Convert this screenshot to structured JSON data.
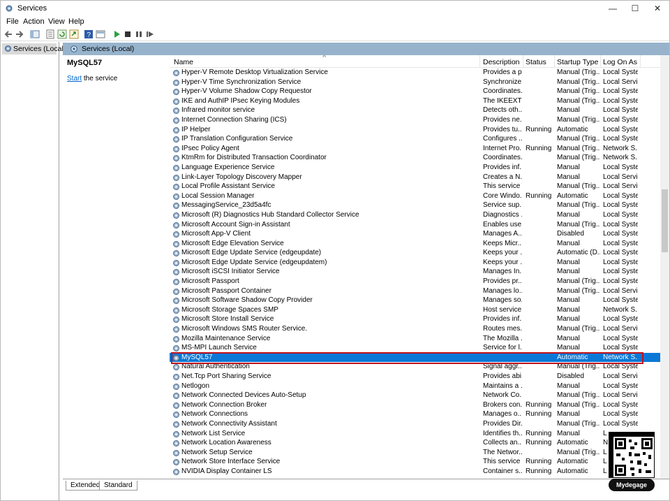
{
  "window": {
    "title": "Services"
  },
  "menu": [
    "File",
    "Action",
    "View",
    "Help"
  ],
  "tree": {
    "item": "Services (Local)"
  },
  "right_header": "Services (Local)",
  "desc_pane": {
    "title": "MySQL57",
    "link": "Start",
    "link_suffix": " the service"
  },
  "columns": [
    "Name",
    "Description",
    "Status",
    "Startup Type",
    "Log On As"
  ],
  "rows": [
    {
      "name": "Hyper-V Remote Desktop Virtualization Service",
      "desc": "Provides a p...",
      "status": "",
      "startup": "Manual (Trig...",
      "logon": "Local Syste..."
    },
    {
      "name": "Hyper-V Time Synchronization Service",
      "desc": "Synchronize...",
      "status": "",
      "startup": "Manual (Trig...",
      "logon": "Local Service"
    },
    {
      "name": "Hyper-V Volume Shadow Copy Requestor",
      "desc": "Coordinates...",
      "status": "",
      "startup": "Manual (Trig...",
      "logon": "Local Syste..."
    },
    {
      "name": "IKE and AuthIP IPsec Keying Modules",
      "desc": "The IKEEXT ...",
      "status": "",
      "startup": "Manual (Trig...",
      "logon": "Local Syste..."
    },
    {
      "name": "Infrared monitor service",
      "desc": "Detects oth...",
      "status": "",
      "startup": "Manual",
      "logon": "Local Syste..."
    },
    {
      "name": "Internet Connection Sharing (ICS)",
      "desc": "Provides ne...",
      "status": "",
      "startup": "Manual (Trig...",
      "logon": "Local Syste..."
    },
    {
      "name": "IP Helper",
      "desc": "Provides tu...",
      "status": "Running",
      "startup": "Automatic",
      "logon": "Local Syste..."
    },
    {
      "name": "IP Translation Configuration Service",
      "desc": "Configures ...",
      "status": "",
      "startup": "Manual (Trig...",
      "logon": "Local Syste..."
    },
    {
      "name": "IPsec Policy Agent",
      "desc": "Internet Pro...",
      "status": "Running",
      "startup": "Manual (Trig...",
      "logon": "Network S..."
    },
    {
      "name": "KtmRm for Distributed Transaction Coordinator",
      "desc": "Coordinates...",
      "status": "",
      "startup": "Manual (Trig...",
      "logon": "Network S..."
    },
    {
      "name": "Language Experience Service",
      "desc": "Provides inf...",
      "status": "",
      "startup": "Manual",
      "logon": "Local Syste..."
    },
    {
      "name": "Link-Layer Topology Discovery Mapper",
      "desc": "Creates a N...",
      "status": "",
      "startup": "Manual",
      "logon": "Local Service"
    },
    {
      "name": "Local Profile Assistant Service",
      "desc": "This service ...",
      "status": "",
      "startup": "Manual (Trig...",
      "logon": "Local Service"
    },
    {
      "name": "Local Session Manager",
      "desc": "Core Windo...",
      "status": "Running",
      "startup": "Automatic",
      "logon": "Local Syste..."
    },
    {
      "name": "MessagingService_23d5a4fc",
      "desc": "Service sup...",
      "status": "",
      "startup": "Manual (Trig...",
      "logon": "Local Syste..."
    },
    {
      "name": "Microsoft (R) Diagnostics Hub Standard Collector Service",
      "desc": "Diagnostics ...",
      "status": "",
      "startup": "Manual",
      "logon": "Local Syste..."
    },
    {
      "name": "Microsoft Account Sign-in Assistant",
      "desc": "Enables use...",
      "status": "",
      "startup": "Manual (Trig...",
      "logon": "Local Syste..."
    },
    {
      "name": "Microsoft App-V Client",
      "desc": "Manages A...",
      "status": "",
      "startup": "Disabled",
      "logon": "Local Syste..."
    },
    {
      "name": "Microsoft Edge Elevation Service",
      "desc": "Keeps Micr...",
      "status": "",
      "startup": "Manual",
      "logon": "Local Syste..."
    },
    {
      "name": "Microsoft Edge Update Service (edgeupdate)",
      "desc": "Keeps your ...",
      "status": "",
      "startup": "Automatic (D...",
      "logon": "Local Syste..."
    },
    {
      "name": "Microsoft Edge Update Service (edgeupdatem)",
      "desc": "Keeps your ...",
      "status": "",
      "startup": "Manual",
      "logon": "Local Syste..."
    },
    {
      "name": "Microsoft iSCSI Initiator Service",
      "desc": "Manages In...",
      "status": "",
      "startup": "Manual",
      "logon": "Local Syste..."
    },
    {
      "name": "Microsoft Passport",
      "desc": "Provides pr...",
      "status": "",
      "startup": "Manual (Trig...",
      "logon": "Local Syste..."
    },
    {
      "name": "Microsoft Passport Container",
      "desc": "Manages lo...",
      "status": "",
      "startup": "Manual (Trig...",
      "logon": "Local Service"
    },
    {
      "name": "Microsoft Software Shadow Copy Provider",
      "desc": "Manages so...",
      "status": "",
      "startup": "Manual",
      "logon": "Local Syste..."
    },
    {
      "name": "Microsoft Storage Spaces SMP",
      "desc": "Host service...",
      "status": "",
      "startup": "Manual",
      "logon": "Network S..."
    },
    {
      "name": "Microsoft Store Install Service",
      "desc": "Provides inf...",
      "status": "",
      "startup": "Manual",
      "logon": "Local Syste..."
    },
    {
      "name": "Microsoft Windows SMS Router Service.",
      "desc": "Routes mes...",
      "status": "",
      "startup": "Manual (Trig...",
      "logon": "Local Service"
    },
    {
      "name": "Mozilla Maintenance Service",
      "desc": "The Mozilla ...",
      "status": "",
      "startup": "Manual",
      "logon": "Local Syste..."
    },
    {
      "name": "MS-MPI Launch Service",
      "desc": "Service for l...",
      "status": "",
      "startup": "Manual",
      "logon": "Local Syste..."
    },
    {
      "name": "MySQL57",
      "desc": "",
      "status": "",
      "startup": "Automatic",
      "logon": "Network S...",
      "selected": true
    },
    {
      "name": "Natural Authentication",
      "desc": "Signal aggr...",
      "status": "",
      "startup": "Manual (Trig...",
      "logon": "Local Syste..."
    },
    {
      "name": "Net.Tcp Port Sharing Service",
      "desc": "Provides abi...",
      "status": "",
      "startup": "Disabled",
      "logon": "Local Service"
    },
    {
      "name": "Netlogon",
      "desc": "Maintains a ...",
      "status": "",
      "startup": "Manual",
      "logon": "Local Syste..."
    },
    {
      "name": "Network Connected Devices Auto-Setup",
      "desc": "Network Co...",
      "status": "",
      "startup": "Manual (Trig...",
      "logon": "Local Service"
    },
    {
      "name": "Network Connection Broker",
      "desc": "Brokers con...",
      "status": "Running",
      "startup": "Manual (Trig...",
      "logon": "Local Syste..."
    },
    {
      "name": "Network Connections",
      "desc": "Manages o...",
      "status": "Running",
      "startup": "Manual",
      "logon": "Local Syste..."
    },
    {
      "name": "Network Connectivity Assistant",
      "desc": "Provides Dir...",
      "status": "",
      "startup": "Manual (Trig...",
      "logon": "Local Syste..."
    },
    {
      "name": "Network List Service",
      "desc": "Identifies th...",
      "status": "Running",
      "startup": "Manual",
      "logon": "L"
    },
    {
      "name": "Network Location Awareness",
      "desc": "Collects an...",
      "status": "Running",
      "startup": "Automatic",
      "logon": "N"
    },
    {
      "name": "Network Setup Service",
      "desc": "The Networ...",
      "status": "",
      "startup": "Manual (Trig...",
      "logon": "L"
    },
    {
      "name": "Network Store Interface Service",
      "desc": "This service ...",
      "status": "Running",
      "startup": "Automatic",
      "logon": "L"
    },
    {
      "name": "NVIDIA Display Container LS",
      "desc": "Container s...",
      "status": "Running",
      "startup": "Automatic",
      "logon": "L"
    }
  ],
  "tabs": [
    "Extended",
    "Standard"
  ],
  "watermark": "Mydegage",
  "colors": {
    "selection": "#0a78d7",
    "header_band": "#97b3cc",
    "highlight_outline": "#c0141c",
    "link": "#0066cc"
  }
}
